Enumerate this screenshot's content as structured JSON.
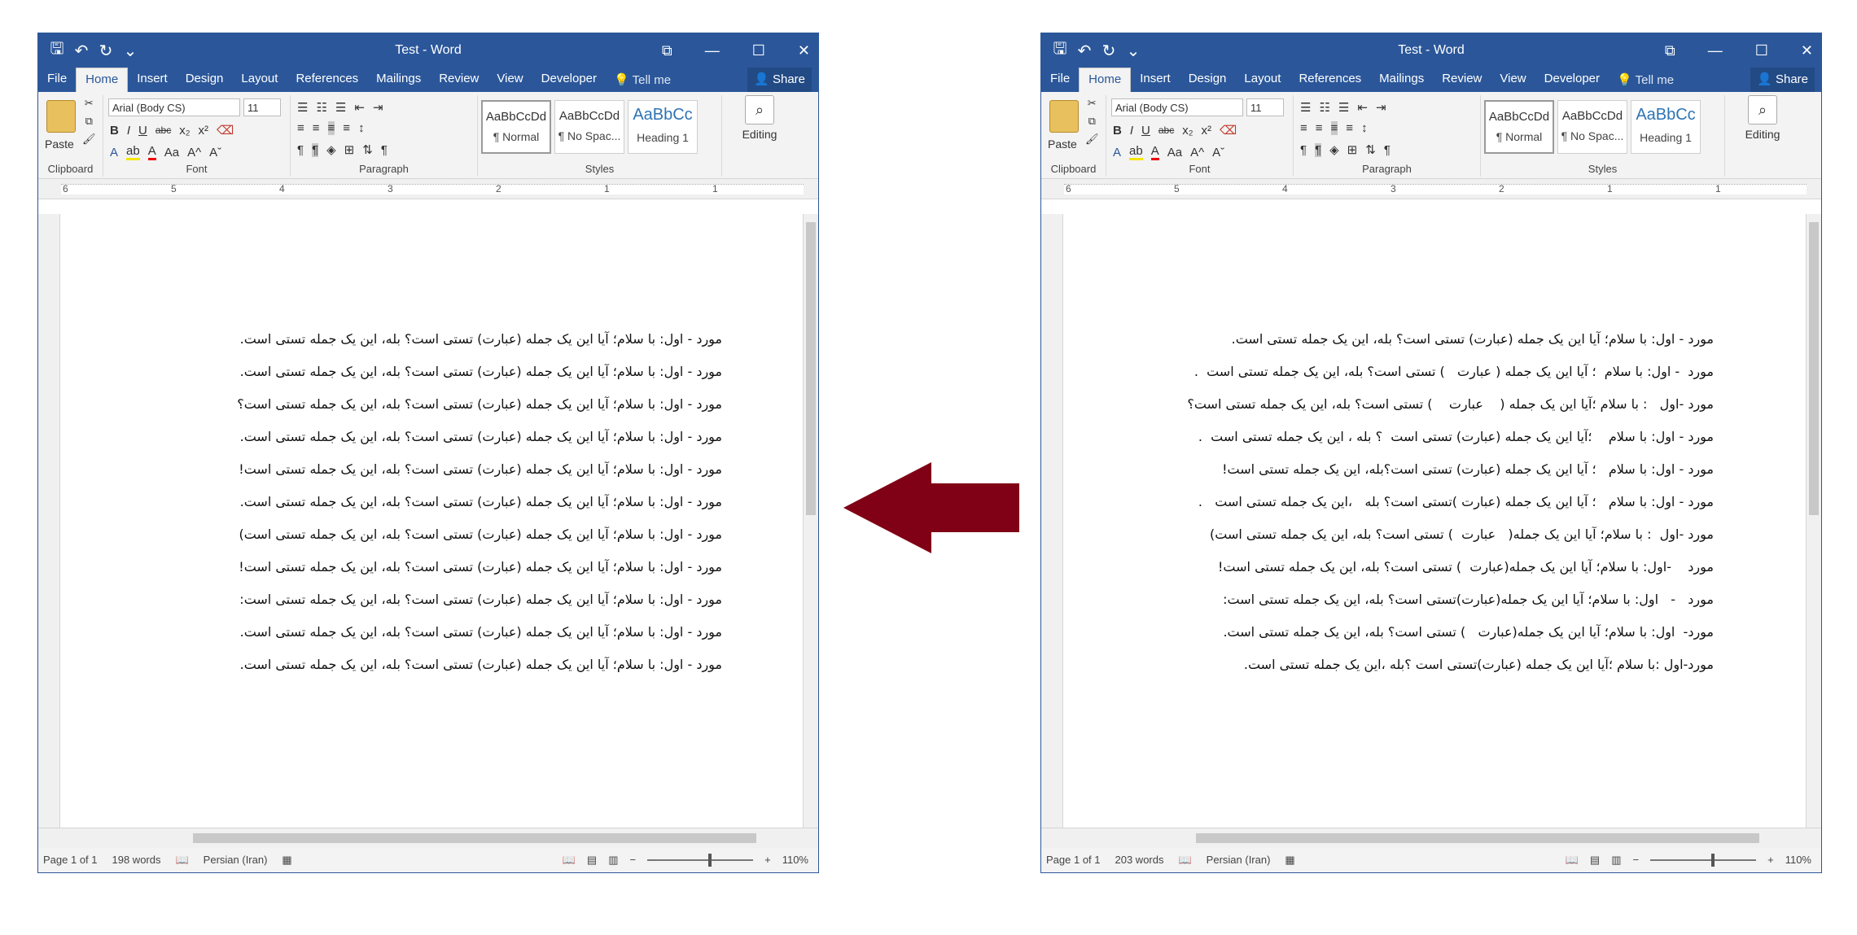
{
  "windows": [
    {
      "title": "Test - Word",
      "tabs": [
        "File",
        "Home",
        "Insert",
        "Design",
        "Layout",
        "References",
        "Mailings",
        "Review",
        "View",
        "Developer"
      ],
      "active_tab": "Home",
      "tellme": "Tell me",
      "share": "Share",
      "font_name": "Arial (Body CS)",
      "font_size": "11",
      "groups": {
        "clipboard": "Clipboard",
        "font": "Font",
        "paragraph": "Paragraph",
        "styles": "Styles"
      },
      "paste_label": "Paste",
      "styles": [
        {
          "preview": "AaBbCcDd",
          "name": "¶ Normal"
        },
        {
          "preview": "AaBbCcDd",
          "name": "¶ No Spac..."
        },
        {
          "preview": "AaBbCc",
          "name": "Heading 1"
        }
      ],
      "editing_label": "Editing",
      "ruler_numbers": [
        "6",
        "5",
        "4",
        "3",
        "2",
        "1",
        "1"
      ],
      "lines": [
        "مورد - اول: با سلام؛ آیا این یک جمله (عبارت) تستی است؟ بله، این یک جمله تستی است.",
        "مورد - اول: با سلام؛ آیا این یک جمله (عبارت) تستی است؟ بله، این یک جمله تستی است.",
        "مورد - اول: با سلام؛ آیا این یک جمله (عبارت) تستی است؟ بله، این یک جمله تستی است؟",
        "مورد - اول: با سلام؛ آیا این یک جمله (عبارت) تستی است؟ بله، این یک جمله تستی است.",
        "مورد - اول: با سلام؛ آیا این یک جمله (عبارت) تستی است؟ بله، این یک جمله تستی است!",
        "مورد - اول: با سلام؛ آیا این یک جمله (عبارت) تستی است؟ بله، این یک جمله تستی است.",
        "مورد - اول: با سلام؛ آیا این یک جمله (عبارت) تستی است؟ بله، این یک جمله تستی است)",
        "مورد - اول: با سلام؛ آیا این یک جمله (عبارت) تستی است؟ بله، این یک جمله تستی است!",
        "مورد - اول: با سلام؛ آیا این یک جمله (عبارت) تستی است؟ بله، این یک جمله تستی است:",
        "مورد - اول: با سلام؛ آیا این یک جمله (عبارت) تستی است؟ بله، این یک جمله تستی است.",
        "مورد - اول: با سلام؛ آیا این یک جمله (عبارت) تستی است؟ بله، این یک جمله تستی است."
      ],
      "status": {
        "page": "Page 1 of 1",
        "words": "198 words",
        "language": "Persian (Iran)",
        "zoom": "110%"
      }
    },
    {
      "title": "Test - Word",
      "tabs": [
        "File",
        "Home",
        "Insert",
        "Design",
        "Layout",
        "References",
        "Mailings",
        "Review",
        "View",
        "Developer"
      ],
      "active_tab": "Home",
      "tellme": "Tell me",
      "share": "Share",
      "font_name": "Arial (Body CS)",
      "font_size": "11",
      "groups": {
        "clipboard": "Clipboard",
        "font": "Font",
        "paragraph": "Paragraph",
        "styles": "Styles"
      },
      "paste_label": "Paste",
      "styles": [
        {
          "preview": "AaBbCcDd",
          "name": "¶ Normal"
        },
        {
          "preview": "AaBbCcDd",
          "name": "¶ No Spac..."
        },
        {
          "preview": "AaBbCc",
          "name": "Heading 1"
        }
      ],
      "editing_label": "Editing",
      "ruler_numbers": [
        "6",
        "5",
        "4",
        "3",
        "2",
        "1",
        "1"
      ],
      "lines": [
        "مورد - اول: با سلام؛ آیا این یک جمله (عبارت) تستی است؟ بله، این یک جمله تستی است.",
        "مورد  - اول: با سلام  ؛ آیا این یک جمله ( عبارت   ) تستی است؟ بله، این یک جمله تستی است  .",
        "مورد -اول   : با سلام ؛آیا این یک جمله (    عبارت    ) تستی است؟ بله، این یک جمله تستی است؟",
        "مورد - اول: با سلام    ؛آیا این یک جمله (عبارت) تستی است  ؟ بله ، این یک جمله تستی است  .",
        "مورد - اول: با سلام   ؛ آیا این یک جمله (عبارت) تستی است؟بله، این یک جمله تستی است!",
        "مورد - اول: با سلام   ؛ آیا این یک جمله (عبارت )تستی است؟ بله   ،این یک جمله تستی است   .",
        "مورد -اول  : با سلام؛ آیا این یک جمله(   عبارت  ) تستی است؟ بله، این یک جمله تستی است)",
        "مورد    -اول: با سلام؛ آیا این یک جمله(عبارت  ) تستی است؟ بله، این یک جمله تستی است!",
        "مورد   -   اول: با سلام؛ آیا این یک جمله(عبارت)تستی است؟ بله، این یک جمله تستی است:",
        "مورد-  اول: با سلام؛ آیا این یک جمله(عبارت   ) تستی است؟ بله، این یک جمله تستی است.",
        "مورد-اول :با سلام ؛آیا این یک جمله (عبارت)تستی است ؟بله ،این یک جمله تستی است."
      ],
      "status": {
        "page": "Page 1 of 1",
        "words": "203 words",
        "language": "Persian (Iran)",
        "zoom": "110%"
      }
    }
  ],
  "arrow_color": "#800015"
}
